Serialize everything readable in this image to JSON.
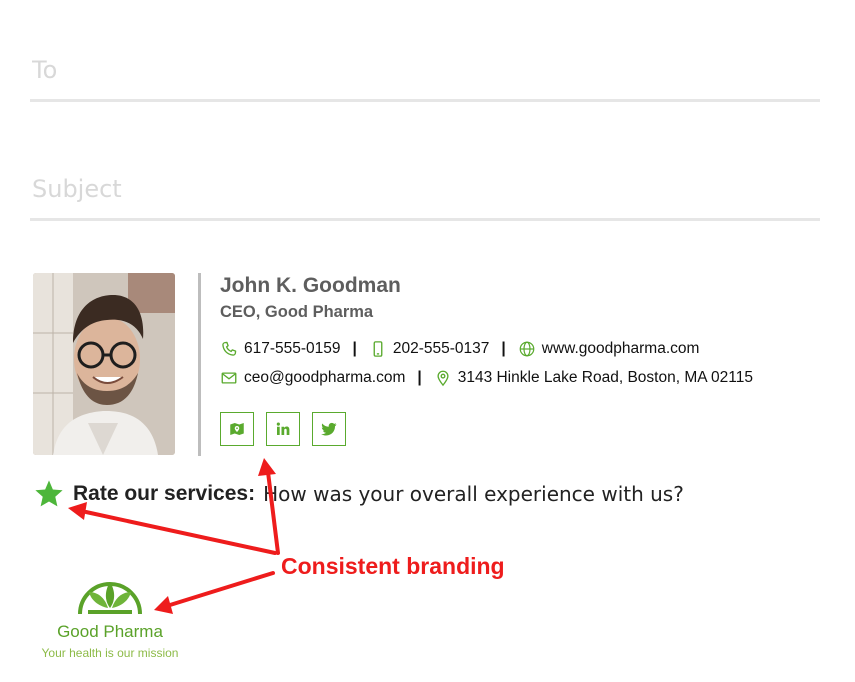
{
  "compose": {
    "to_placeholder": "To",
    "subject_placeholder": "Subject"
  },
  "signature": {
    "name": "John K. Goodman",
    "title": "CEO, Good Pharma",
    "phone": "617-555-0159",
    "mobile": "202-555-0137",
    "website": "www.goodpharma.com",
    "email": "ceo@goodpharma.com",
    "address": "3143 Hinkle Lake Road, Boston, MA 02115",
    "separator": "|",
    "social_icons": [
      "map-icon",
      "linkedin-icon",
      "twitter-icon"
    ]
  },
  "rating": {
    "label": "Rate our services:",
    "question": "How was your overall experience with us?"
  },
  "annotation": {
    "callout": "Consistent branding"
  },
  "logo": {
    "name": "Good Pharma",
    "tagline": "Your health is our mission"
  },
  "colors": {
    "brand_green": "#5aaa2e",
    "annotation_red": "#ee1c1c",
    "divider_gray": "#e6e6e6"
  }
}
